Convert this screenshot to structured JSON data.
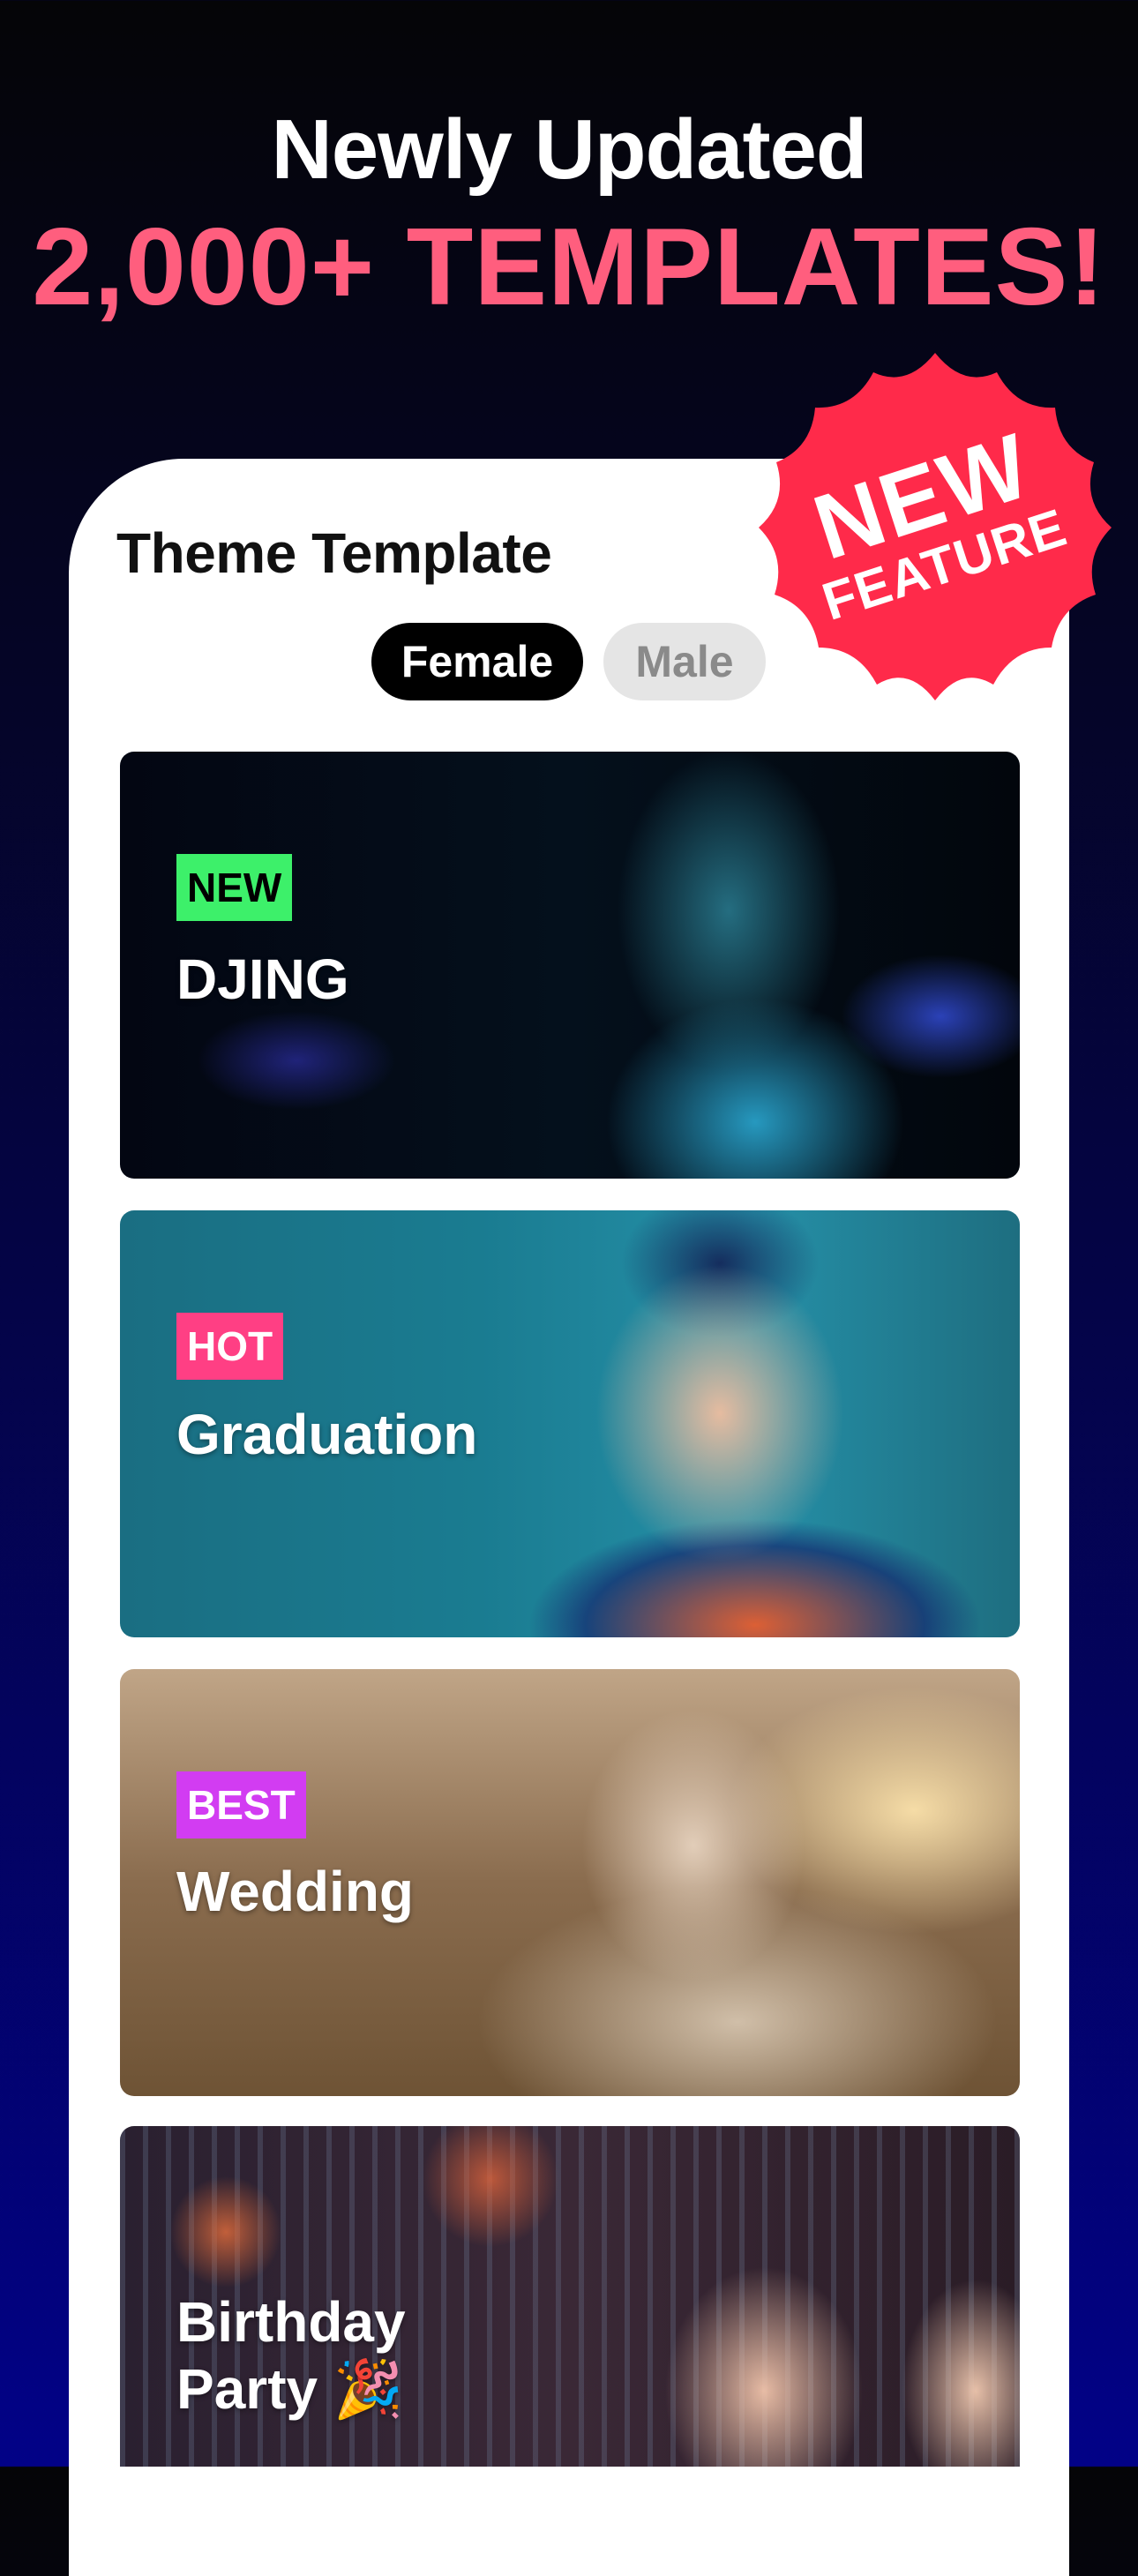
{
  "header": {
    "headline": "Newly Updated",
    "subheadline": "2,000+ TEMPLATES!"
  },
  "badge": {
    "line1": "NEW",
    "line2": "FEATURE",
    "color": "#ff2a4a"
  },
  "section": {
    "title": "Theme Template"
  },
  "gender_toggle": {
    "options": [
      "Female",
      "Male"
    ],
    "selected": "Female"
  },
  "templates": [
    {
      "tag": "NEW",
      "tag_color": "#3df06a",
      "tag_text_color": "#000000",
      "title": "DJING"
    },
    {
      "tag": "HOT",
      "tag_color": "#ff3f84",
      "tag_text_color": "#ffffff",
      "title": "Graduation"
    },
    {
      "tag": "BEST",
      "tag_color": "#d23cf2",
      "tag_text_color": "#ffffff",
      "title": "Wedding"
    },
    {
      "tag": "",
      "title_line1": "Birthday",
      "title_line2": "Party 🎉"
    }
  ],
  "colors": {
    "accent_pink": "#ff5e7e",
    "toggle_active": "#000000",
    "toggle_inactive": "#e5e5e5"
  }
}
